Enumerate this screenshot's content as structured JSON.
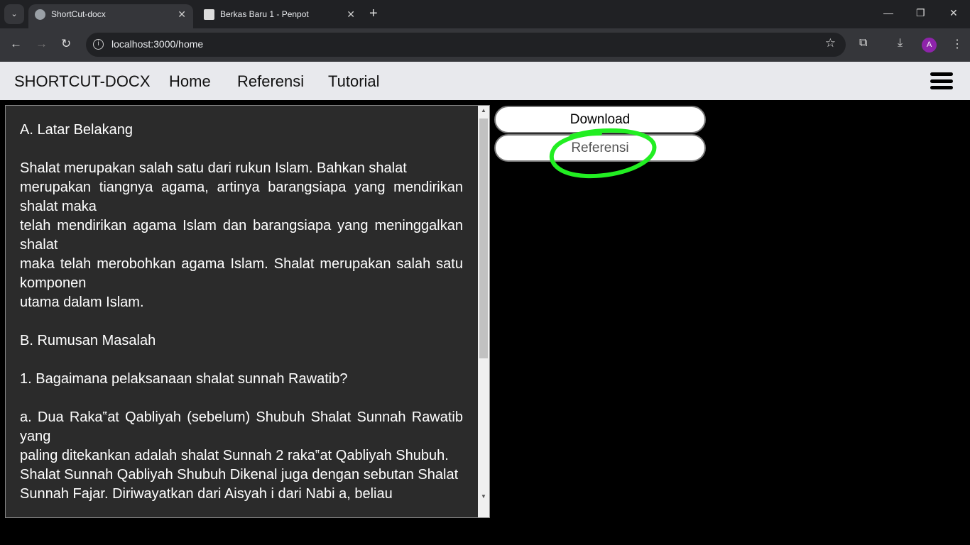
{
  "browser": {
    "tabs": [
      {
        "title": "ShortCut-docx",
        "active": true
      },
      {
        "title": "Berkas Baru 1 - Penpot",
        "active": false
      }
    ],
    "url": "localhost:3000/home",
    "profile_initial": "A"
  },
  "app": {
    "brand": "SHORTCUT-DOCX",
    "nav": [
      "Home",
      "Referensi",
      "Tutorial"
    ]
  },
  "document": {
    "paragraphs": [
      "A. Latar Belakang",
      "",
      "Shalat merupakan salah satu dari rukun Islam. Bahkan shalat",
      "merupakan tiangnya agama, artinya barangsiapa yang mendirikan shalat maka",
      "telah mendirikan agama Islam dan barangsiapa yang meninggalkan shalat",
      "maka telah merobohkan agama Islam. Shalat merupakan salah satu komponen",
      "utama dalam Islam.",
      "",
      "B. Rumusan Masalah",
      "",
      "1. Bagaimana pelaksanaan shalat sunnah Rawatib?",
      "",
      "a. Dua Raka‟at Qabliyah (sebelum) Shubuh Shalat Sunnah Rawatib yang",
      "paling ditekankan adalah shalat Sunnah 2 raka‟at Qabliyah Shubuh.",
      "Shalat Sunnah Qabliyah Shubuh Dikenal juga dengan sebutan Shalat",
      "Sunnah Fajar. Diriwayatkan dari Aisyah i dari Nabi a, beliau"
    ]
  },
  "actions": {
    "download": "Download",
    "referensi": "Referensi"
  },
  "colors": {
    "highlight": "#22ee22",
    "panel": "#2b2b2b"
  }
}
